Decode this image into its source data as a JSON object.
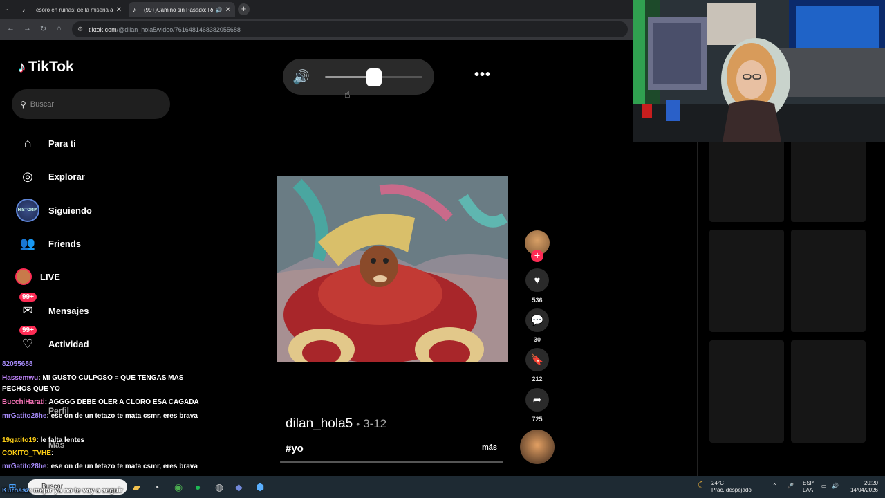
{
  "browser": {
    "tabs": [
      {
        "title": "Tesoro en ruinas: de la miseria a...",
        "close": "✕"
      },
      {
        "title": "(99+)Camino sin Pasado: Re...",
        "close": "✕",
        "audio": "🔊"
      }
    ],
    "url_host": "tiktok.com",
    "url_path": "/@dilan_hola5/video/7616481468382055688"
  },
  "sidebar": {
    "logo": "TikTok",
    "search_placeholder": "Buscar",
    "items": [
      {
        "label": "Para ti"
      },
      {
        "label": "Explorar"
      },
      {
        "label": "Siguiendo",
        "avatar_text": "HISTORIA"
      },
      {
        "label": "Friends"
      },
      {
        "label": "LIVE"
      },
      {
        "label": "Mensajes",
        "badge": "99+"
      },
      {
        "label": "Actividad",
        "badge": "99+"
      },
      {
        "label": "Perfil"
      },
      {
        "label": "Más"
      }
    ]
  },
  "player": {
    "volume": 0.5,
    "progress": 0.0,
    "author": "dilan_hola5",
    "date": "3-12",
    "hashtag": "#yo",
    "more_label": "más"
  },
  "actions": {
    "likes": "536",
    "comments": "30",
    "saves": "212",
    "shares": "725"
  },
  "chat": [
    {
      "user": "82055688",
      "text": "",
      "color": "#a78bfa"
    },
    {
      "user": "Hassemwu",
      "text": ": MI GUSTO CULPOSO = QUE TENGAS MAS PECHOS QUE YO",
      "color": "#c084fc"
    },
    {
      "user": "BucchiHarati",
      "text": ": AGGGG DEBE OLER A CLORO ESA CAGADA",
      "color": "#f472b6"
    },
    {
      "user": "mrGatito28he",
      "text": ": ese on de un tetazo te mata csmr, eres brava",
      "color": "#a78bfa"
    },
    {
      "user": "19gatito19",
      "text": ": le falta lentes",
      "color": "#facc15"
    },
    {
      "user": "COKITO_TVHE",
      "text": ":",
      "color": "#facc15"
    },
    {
      "user": "mrGatito28he",
      "text": ": ese on de un tetazo te mata csmr, eres brava",
      "color": "#a78bfa"
    },
    {
      "user": "Kurhasz",
      "text": ": mejor ya no te voy a seguir",
      "color": "#60a5fa"
    }
  ],
  "taskbar": {
    "search_placeholder": "Buscar",
    "weather_temp": "24°C",
    "weather_desc": "Prac. despejado",
    "lang": "ESP",
    "lang2": "LAA",
    "time": "20:20",
    "date": "14/04/2026"
  },
  "colors": {
    "accent": "#fe2c55",
    "cyan": "#25f4ee"
  }
}
